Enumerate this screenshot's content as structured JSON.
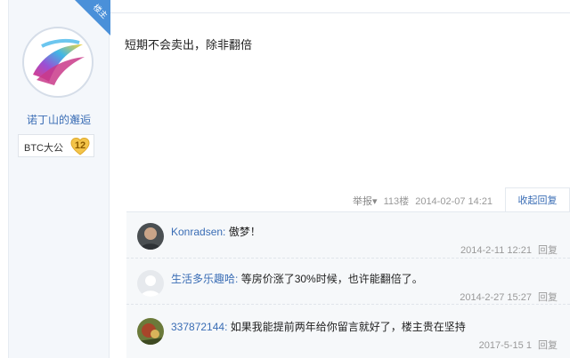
{
  "author": {
    "badge": "楼主",
    "name": "诺丁山的邂逅",
    "level_label": "BTC大公",
    "level_num": "12"
  },
  "post": {
    "content": "短期不会卖出，除非翻倍",
    "report": "举报▾",
    "floor": "113楼",
    "time": "2014-02-07 14:21",
    "toggle_reply": "收起回复"
  },
  "replies": [
    {
      "user": "Konradsen:",
      "text": "傲梦！",
      "time": "2014-2-11 12:21",
      "reply": "回复"
    },
    {
      "user": "生活多乐趣哈:",
      "text": "等房价涨了30%时候，也许能翻倍了。",
      "time": "2014-2-27 15:27",
      "reply": "回复"
    },
    {
      "user": "337872144:",
      "text": "如果我能提前两年给你留言就好了，楼主贵在坚持",
      "time": "2017-5-15 1",
      "reply": "回复"
    }
  ],
  "colors": {
    "link": "#3a6db5",
    "badge": "#4a90d9",
    "level_gold": "#f3c44a"
  }
}
